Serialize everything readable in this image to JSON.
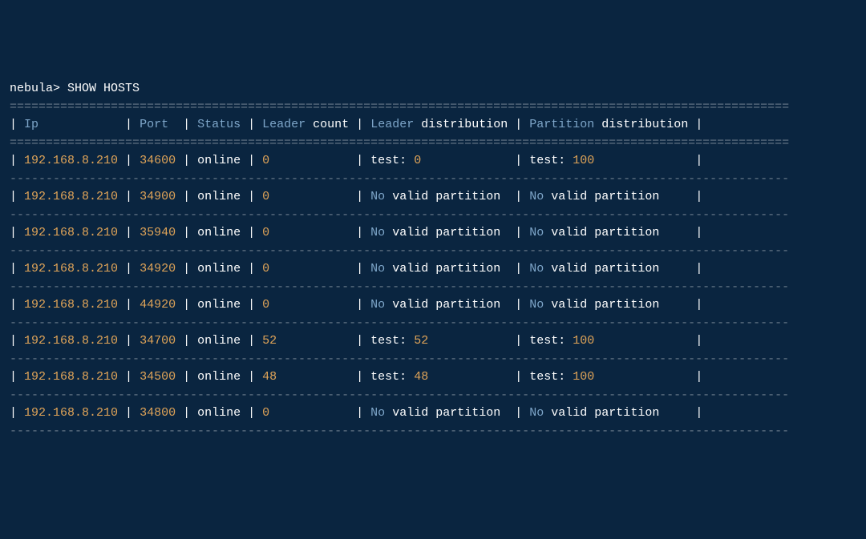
{
  "prompt": "nebula>",
  "command": "SHOW HOSTS",
  "rule_double": "============================================================================================================",
  "rule_single": "------------------------------------------------------------------------------------------------------------",
  "headers": {
    "ip": "Ip",
    "port": "Port",
    "status": "Status",
    "leader_a": "Leader",
    "leader_b": "count",
    "ldist_a": "Leader",
    "ldist_b": "distribution",
    "pdist_a": "Partition",
    "pdist_b": "distribution"
  },
  "rows": [
    {
      "ip": "192.168.8.210",
      "port": "34600",
      "status": "online",
      "leader": "0",
      "ldist": {
        "type": "test",
        "k": "test:",
        "v": "0"
      },
      "pdist": {
        "type": "test",
        "k": "test:",
        "v": "100"
      }
    },
    {
      "ip": "192.168.8.210",
      "port": "34900",
      "status": "online",
      "leader": "0",
      "ldist": {
        "type": "novalid",
        "a": "No",
        "b": "valid partition"
      },
      "pdist": {
        "type": "novalid",
        "a": "No",
        "b": "valid partition"
      }
    },
    {
      "ip": "192.168.8.210",
      "port": "35940",
      "status": "online",
      "leader": "0",
      "ldist": {
        "type": "novalid",
        "a": "No",
        "b": "valid partition"
      },
      "pdist": {
        "type": "novalid",
        "a": "No",
        "b": "valid partition"
      }
    },
    {
      "ip": "192.168.8.210",
      "port": "34920",
      "status": "online",
      "leader": "0",
      "ldist": {
        "type": "novalid",
        "a": "No",
        "b": "valid partition"
      },
      "pdist": {
        "type": "novalid",
        "a": "No",
        "b": "valid partition"
      }
    },
    {
      "ip": "192.168.8.210",
      "port": "44920",
      "status": "online",
      "leader": "0",
      "ldist": {
        "type": "novalid",
        "a": "No",
        "b": "valid partition"
      },
      "pdist": {
        "type": "novalid",
        "a": "No",
        "b": "valid partition"
      }
    },
    {
      "ip": "192.168.8.210",
      "port": "34700",
      "status": "online",
      "leader": "52",
      "ldist": {
        "type": "test",
        "k": "test:",
        "v": "52"
      },
      "pdist": {
        "type": "test",
        "k": "test:",
        "v": "100"
      }
    },
    {
      "ip": "192.168.8.210",
      "port": "34500",
      "status": "online",
      "leader": "48",
      "ldist": {
        "type": "test",
        "k": "test:",
        "v": "48"
      },
      "pdist": {
        "type": "test",
        "k": "test:",
        "v": "100"
      }
    },
    {
      "ip": "192.168.8.210",
      "port": "34800",
      "status": "online",
      "leader": "0",
      "ldist": {
        "type": "novalid",
        "a": "No",
        "b": "valid partition"
      },
      "pdist": {
        "type": "novalid",
        "a": "No",
        "b": "valid partition"
      }
    }
  ],
  "widths": {
    "ip": 13,
    "port": 5,
    "status": 6,
    "leader": 12,
    "ldist": 19,
    "pdist": 22
  }
}
